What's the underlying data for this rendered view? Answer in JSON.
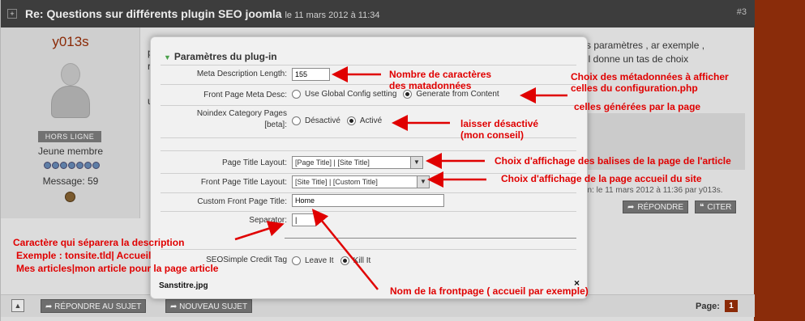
{
  "post": {
    "title": "Re: Questions sur différents plugin SEO joomla",
    "date": "le 11 mars 2012 à 11:34",
    "number": "#3",
    "toggle_glyph": "+"
  },
  "user": {
    "name": "y013s",
    "status": "HORS LIGNE",
    "rank": "Jeune membre",
    "messages": "Message: 59",
    "avatar_icon": "user-silhouette-icon"
  },
  "post_body": {
    "line1": "s paramètres , ar exemple ,",
    "line2": "il donne un tas de choix",
    "left_r1": "p",
    "left_r2": "r",
    "left_u": "u",
    "edit_note": "on: le 11 mars 2012 à 11:36 par y013s.",
    "reply_btn": "RÉPONDRE",
    "quote_btn": "CITER"
  },
  "footer": {
    "reply_subject": "RÉPONDRE AU SUJET",
    "new_subject": "NOUVEAU SUJET",
    "page_label": "Page:",
    "page_num": "1"
  },
  "dialog": {
    "panel_title": "Paramètres du plug-in",
    "meta_length_label": "Meta Description Length:",
    "meta_length_value": "155",
    "front_meta_label": "Front Page Meta Desc:",
    "front_meta_opt1": "Use Global Config setting",
    "front_meta_opt2": "Generate from Content",
    "noindex_label": "Noindex Category Pages [beta]:",
    "noindex_opt1": "Désactivé",
    "noindex_opt2": "Activé",
    "page_title_layout_label": "Page Title Layout:",
    "page_title_layout_value": "[Page Title] | [Site Title]",
    "front_title_layout_label": "Front Page Title Layout:",
    "front_title_layout_value": "[Site Title] | [Custom Title]",
    "custom_front_label": "Custom Front Page Title:",
    "custom_front_value": "Home",
    "separator_label": "Separator:",
    "separator_value": "|",
    "credit_label": "SEOSimple Credit Tag",
    "credit_opt1": "Leave It",
    "credit_opt2": "Kill It",
    "filename": "Sanstitre.jpg",
    "close": "×"
  },
  "annotations": {
    "a1_l1": "Nombre de caractères",
    "a1_l2": "des matadonnées",
    "a2_l1": "Choix des métadonnées à afficher",
    "a2_l2": "celles du configuration.php",
    "a2_l3": "celles générées par la page",
    "a3_l1": "laisser désactivé",
    "a3_l2": "(mon conseil)",
    "a4": "Choix d'affichage des balises de la page de l'article",
    "a5": "Choix d'affichage de la page accueil du site",
    "a6_l1": "Caractère qui séparera la description",
    "a6_l2": "Exemple : tonsite.tld| Accueil",
    "a6_l3": "Mes articles|mon article pour la page article",
    "a7": "Nom de la frontpage ( accueil par exemple)"
  },
  "colors": {
    "annotation": "#e00000",
    "brand": "#8b2a07",
    "radio_accent": "#4aa04a"
  }
}
